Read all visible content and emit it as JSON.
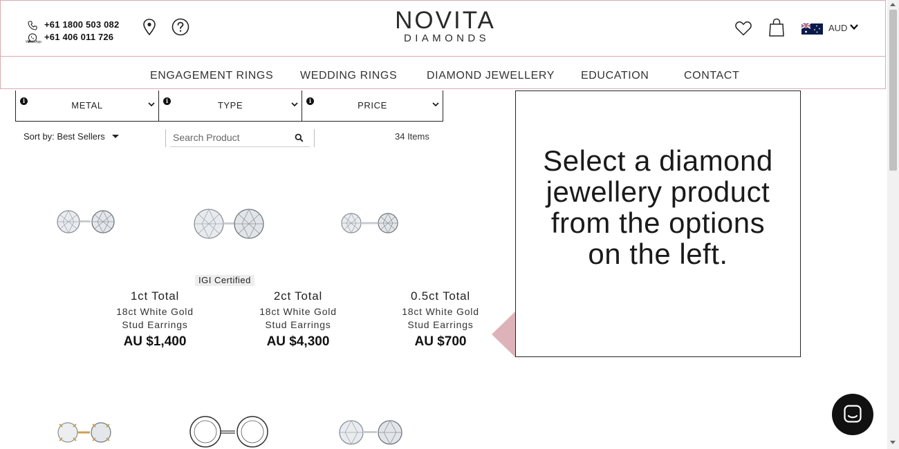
{
  "header": {
    "phones": [
      {
        "icon": "phone-icon",
        "number": "+61 1800 503 082"
      },
      {
        "icon": "whatsapp-icon",
        "number": "+61 406 011 726"
      }
    ],
    "whatsapp_label": "WhatsApp",
    "logo": {
      "top": "NOVITA",
      "bottom": "DIAMONDS"
    },
    "currency": "AUD",
    "nav": [
      "ENGAGEMENT RINGS",
      "WEDDING RINGS",
      "DIAMOND JEWELLERY",
      "EDUCATION",
      "CONTACT"
    ]
  },
  "filters": [
    {
      "label": "METAL"
    },
    {
      "label": "TYPE"
    },
    {
      "label": "PRICE"
    }
  ],
  "toolbar": {
    "sort_label": "Sort by: Best Sellers",
    "search_placeholder": "Search Product",
    "items_count": "34 Items"
  },
  "products": [
    {
      "badge": "",
      "title": "1ct Total",
      "line1": "18ct White Gold",
      "line2": "Stud Earrings",
      "price": "AU $1,400"
    },
    {
      "badge": "IGI Certified",
      "title": "2ct Total",
      "line1": "18ct White Gold",
      "line2": "Stud Earrings",
      "price": "AU $4,300"
    },
    {
      "badge": "",
      "title": "0.5ct Total",
      "line1": "18ct White Gold",
      "line2": "Stud Earrings",
      "price": "AU $700"
    }
  ],
  "panel": {
    "message_lines": [
      "Select a diamond",
      "jewellery product",
      "from the options",
      "on the left."
    ]
  },
  "colors": {
    "accent_pink": "#ddb3b9",
    "border_pink": "#d9a9b2",
    "text": "#1a1a1a"
  }
}
